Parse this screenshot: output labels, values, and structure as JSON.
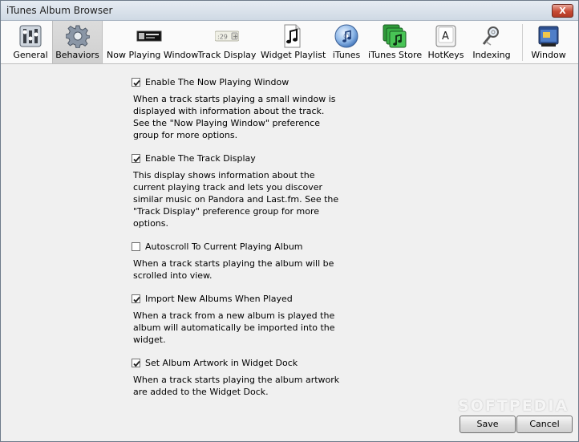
{
  "window": {
    "title": "iTunes Album Browser",
    "close_label": "X"
  },
  "toolbar": {
    "items": [
      {
        "label": "General",
        "icon": "general-icon"
      },
      {
        "label": "Behaviors",
        "icon": "gear-icon",
        "selected": true
      },
      {
        "label": "Now Playing Window",
        "icon": "now-playing-icon"
      },
      {
        "label": "Track Display",
        "icon": "track-display-icon",
        "badge": ":29"
      },
      {
        "label": "Widget Playlist",
        "icon": "music-note-icon"
      },
      {
        "label": "iTunes",
        "icon": "itunes-cd-icon"
      },
      {
        "label": "iTunes Store",
        "icon": "itunes-store-icon"
      },
      {
        "label": "HotKeys",
        "icon": "key-icon",
        "key_letter": "A"
      },
      {
        "label": "Indexing",
        "icon": "magnifier-icon"
      },
      {
        "label": "Window",
        "icon": "window-icon"
      }
    ]
  },
  "options": [
    {
      "label": "Enable The Now Playing Window",
      "checked": true,
      "description": "When a track starts playing a small window is displayed with information about the track. See the \"Now Playing Window\" preference group for more options."
    },
    {
      "label": "Enable The Track Display",
      "checked": true,
      "description": "This display shows information about the current playing track and lets you discover similar music on Pandora and Last.fm. See the \"Track Display\" preference group for more options."
    },
    {
      "label": "Autoscroll To Current Playing Album",
      "checked": false,
      "description": "When a track starts playing the album will be scrolled into view."
    },
    {
      "label": "Import New Albums When Played",
      "checked": true,
      "description": "When a track from a new album is played the album will automatically be imported into the widget."
    },
    {
      "label": "Set Album Artwork in Widget Dock",
      "checked": true,
      "description": "When a track starts playing the album artwork are added to the Widget Dock."
    }
  ],
  "buttons": {
    "save": "Save",
    "cancel": "Cancel"
  },
  "watermark": "SOFTPEDIA",
  "colors": {
    "selected_tab": "#d3d3d3",
    "close_button": "#c74a34",
    "background": "#f0f0f0"
  }
}
